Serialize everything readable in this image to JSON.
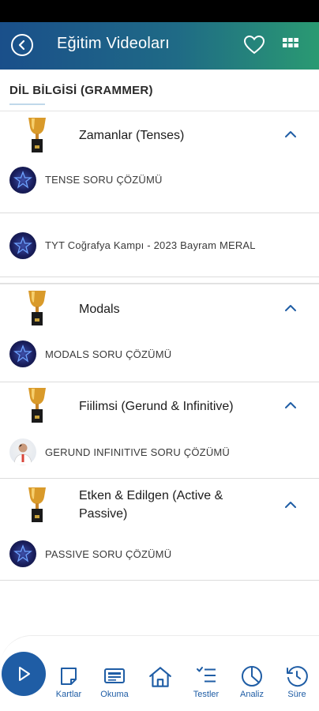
{
  "header": {
    "title": "Eğitim Videoları",
    "back_icon": "back-icon",
    "favorite_icon": "heart-icon",
    "grid_icon": "grid-icon"
  },
  "category": {
    "title": "DİL BİLGİSİ (GRAMMER)"
  },
  "topics": [
    {
      "title": "Zamanlar (Tenses)",
      "videos": [
        "TENSE SORU ÇÖZÜMÜ",
        "TYT Coğrafya Kampı - 2023 Bayram MERAL"
      ]
    },
    {
      "title": "Modals",
      "videos": [
        "MODALS SORU ÇÖZÜMÜ"
      ]
    },
    {
      "title": "Fiilimsi (Gerund & Infinitive)",
      "videos": [
        "GERUND INFINITIVE SORU ÇÖZÜMÜ"
      ]
    },
    {
      "title": "Etken & Edilgen (Active & Passive)",
      "videos": [
        "PASSIVE SORU ÇÖZÜMÜ"
      ]
    }
  ],
  "bottom_nav": {
    "play_icon": "play-icon",
    "items": [
      {
        "label": "Kartlar",
        "icon": "card-icon"
      },
      {
        "label": "Okuma",
        "icon": "reading-icon"
      },
      {
        "label": "",
        "icon": "home-icon"
      },
      {
        "label": "Testler",
        "icon": "checklist-icon"
      },
      {
        "label": "Analiz",
        "icon": "pie-chart-icon"
      },
      {
        "label": "Süre",
        "icon": "history-clock-icon"
      }
    ]
  },
  "colors": {
    "accent": "#1f5da5",
    "header_start": "#1a4f8a",
    "header_end": "#2a9a72"
  }
}
